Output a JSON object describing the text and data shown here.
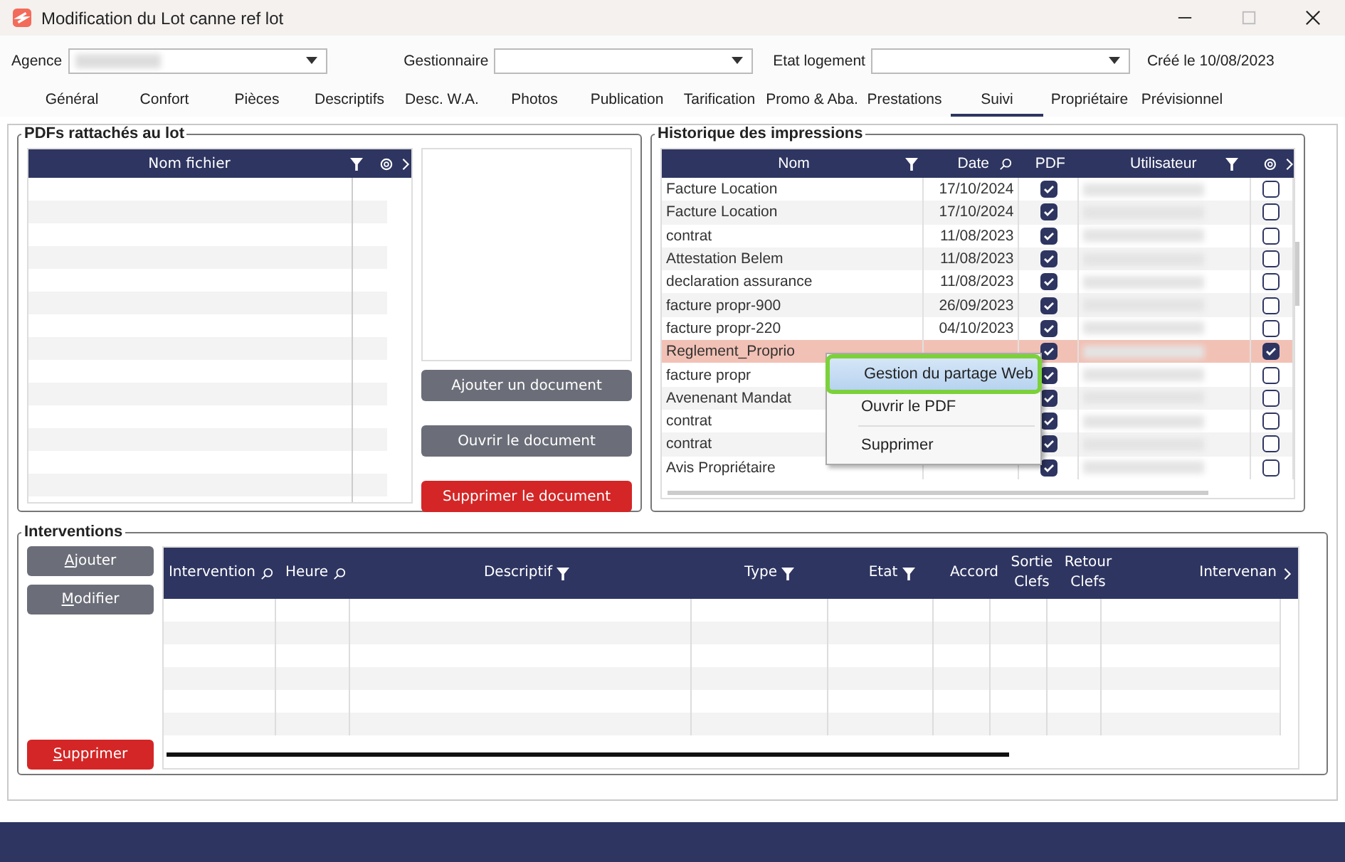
{
  "window": {
    "title": "Modification du Lot canne ref lot"
  },
  "filters": [
    {
      "label": "Agence",
      "kind": "redacted"
    },
    {
      "label": "Gestionnaire",
      "kind": "empty"
    },
    {
      "label": "Etat logement",
      "kind": "empty"
    }
  ],
  "created": "Créé le 10/08/2023",
  "tabs": [
    {
      "label": "Général",
      "selected": false
    },
    {
      "label": "Confort",
      "selected": false
    },
    {
      "label": "Pièces",
      "selected": false
    },
    {
      "label": "Descriptifs",
      "selected": false
    },
    {
      "label": "Desc. W.A.",
      "selected": false
    },
    {
      "label": "Photos",
      "selected": false
    },
    {
      "label": "Publication",
      "selected": false
    },
    {
      "label": "Tarification",
      "selected": false
    },
    {
      "label": "Promo & Aba.",
      "selected": false
    },
    {
      "label": "Prestations",
      "selected": false
    },
    {
      "label": "Suivi",
      "selected": true
    },
    {
      "label": "Propriétaire",
      "selected": false
    },
    {
      "label": "Prévisionnel",
      "selected": false
    }
  ],
  "pdf_panel": {
    "title": "PDFs rattachés au lot",
    "columns": [
      {
        "label": "Nom fichier",
        "kind": "filter"
      }
    ],
    "buttons": [
      {
        "label": "Ajouter un document",
        "kind": "neutral"
      },
      {
        "label": "Ouvrir le document",
        "kind": "neutral"
      },
      {
        "label": "Supprimer le document",
        "kind": "danger"
      }
    ]
  },
  "history": {
    "title": "Historique des impressions",
    "columns": [
      {
        "label": "Nom",
        "kind": "filter"
      },
      {
        "label": "Date",
        "kind": "search"
      },
      {
        "label": "PDF",
        "kind": "plain"
      },
      {
        "label": "Utilisateur",
        "kind": "filter"
      }
    ],
    "rows": [
      {
        "nom": "Facture Location",
        "date": "17/10/2024",
        "pdf": true,
        "web": false,
        "selected": false
      },
      {
        "nom": "Facture Location",
        "date": "17/10/2024",
        "pdf": true,
        "web": false,
        "selected": false
      },
      {
        "nom": "contrat",
        "date": "11/08/2023",
        "pdf": true,
        "web": false,
        "selected": false
      },
      {
        "nom": "Attestation Belem",
        "date": "11/08/2023",
        "pdf": true,
        "web": false,
        "selected": false
      },
      {
        "nom": "declaration assurance",
        "date": "11/08/2023",
        "pdf": true,
        "web": false,
        "selected": false
      },
      {
        "nom": "facture propr-900",
        "date": "26/09/2023",
        "pdf": true,
        "web": false,
        "selected": false
      },
      {
        "nom": "facture propr-220",
        "date": "04/10/2023",
        "pdf": true,
        "web": false,
        "selected": false
      },
      {
        "nom": "Reglement_Proprio",
        "pdf": true,
        "web": true,
        "selected": true
      },
      {
        "nom": "facture propr",
        "pdf": true,
        "web": false,
        "selected": false
      },
      {
        "nom": "Avenenant Mandat",
        "pdf": true,
        "web": false,
        "selected": false
      },
      {
        "nom": "contrat",
        "pdf": true,
        "web": false,
        "selected": false
      },
      {
        "nom": "contrat",
        "pdf": true,
        "web": false,
        "selected": false
      },
      {
        "nom": "Avis Propriétaire",
        "pdf": true,
        "web": false,
        "selected": false
      }
    ],
    "context_menu": [
      {
        "label": "Gestion du partage Web",
        "highlighted": true
      },
      {
        "label": "Ouvrir le PDF",
        "highlighted": false
      },
      {
        "label": "Supprimer",
        "highlighted": false
      }
    ]
  },
  "interventions": {
    "title": "Interventions",
    "buttons": [
      {
        "label": "Ajouter",
        "kind": "neutral"
      },
      {
        "label": "Modifier",
        "kind": "neutral"
      },
      {
        "label": "Supprimer",
        "kind": "danger"
      }
    ],
    "columns": [
      {
        "label": "Intervention",
        "kind": "search"
      },
      {
        "label": "Heure",
        "kind": "search"
      },
      {
        "label": "Descriptif",
        "kind": "filter"
      },
      {
        "label": "Type",
        "kind": "filter"
      },
      {
        "label": "Etat",
        "kind": "filter"
      },
      {
        "label": "Accord",
        "kind": "plain"
      },
      {
        "label": "Sortie Clefs",
        "kind": "plain"
      },
      {
        "label": "Retour Clefs",
        "kind": "plain"
      },
      {
        "label": "Intervenan",
        "kind": "next"
      }
    ]
  }
}
